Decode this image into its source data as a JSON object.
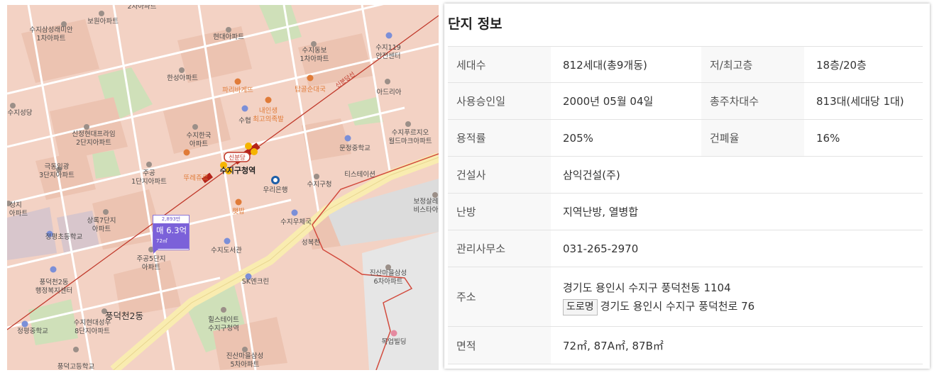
{
  "map": {
    "labels": {
      "suji_samsung_raemian": [
        "수지삼성래미안",
        "1차아파트"
      ],
      "bowon_apt": "보원아파트",
      "hyundai_apt": "현대아파트",
      "suji_dongbo": [
        "수지동보",
        "1차아파트"
      ],
      "suji_119": [
        "수지119",
        "안전센터"
      ],
      "hansung_apt": "한성아파트",
      "paris_baguette": "파리바게뜨",
      "tapgol": "탑골순대국",
      "adria": "아드리아",
      "suji_seongdang": "수지성당",
      "suhyup": "수협",
      "naeinsaeng": [
        "내인생",
        "최고의족발"
      ],
      "sinjeong_hyundai": [
        "신정현대프라임",
        "2단지아파트"
      ],
      "suji_hanguk": [
        "수지한국",
        "아파트"
      ],
      "munjeong_school": "문정중학교",
      "suji_purgio": [
        "수지푸르지오",
        "월드마크아파트"
      ],
      "geukdong": [
        "극동임광",
        "3단지아파트"
      ],
      "jugong1": [
        "주공",
        "1단지아파트"
      ],
      "tous_les_jours": "뚜레쥬르",
      "suji_gu_station": "수지구청역",
      "sinbundang": "신분당",
      "sinbundang_line": "신분당선",
      "woori_bank": "우리은행",
      "suji_gu_office": "수지구청",
      "tistation": "티스테이션",
      "bojeong": [
        "보정살레",
        "비스타아"
      ],
      "suji_left": [
        "성지",
        "아파트"
      ],
      "sangnok7": [
        "상록7단지",
        "아파트"
      ],
      "haengbap": "햇밥",
      "suji_post": "수지우체국",
      "jeongpyeong_elem": "정평초등학교",
      "jugong5": [
        "주공5단지",
        "아파트"
      ],
      "suji_library": "수지도서관",
      "seongbokcheon": "성복천",
      "pungdeokcheon2_center": [
        "풍덕천2동",
        "행정복지센터"
      ],
      "sk_enclean": "SK엔크린",
      "jinsan3": [
        "진산마을삼성",
        "6차아파트"
      ],
      "pungdeokcheon2": "풍덕천2동",
      "suji_hyundai_seongu": [
        "수지현대성우",
        "8단지아파트"
      ],
      "hillstate": [
        "힐스테이트",
        "수지구청역"
      ],
      "jeongpyeong_mid": "정평중학교",
      "mokeup": "목업빌딩",
      "jinsan5": [
        "진산마을삼성",
        "5차아파트"
      ],
      "pungdeok_high": "풍덕고등학교",
      "top_cut": "2차아파트"
    },
    "marker": {
      "count": "2,893만",
      "price": "매 6.3억",
      "area": "72㎡"
    },
    "colors": {
      "land": "#f3d2c4",
      "block": "#ecc3b1",
      "park": "#cfe0b9",
      "road": "#ffffff",
      "main_road": "#f9ecb0",
      "rail": "#c0392b",
      "marker": "#7b61d9"
    }
  },
  "panel": {
    "title": "단지 정보",
    "rows": [
      {
        "k1": "세대수",
        "v1": "812세대(총9개동)",
        "k2": "저/최고층",
        "v2": "18층/20층"
      },
      {
        "k1": "사용승인일",
        "v1": "2000년 05월 04일",
        "k2": "총주차대수",
        "v2": "813대(세대당 1대)"
      },
      {
        "k1": "용적률",
        "v1": "205%",
        "k2": "건폐율",
        "v2": "16%"
      },
      {
        "k1": "건설사",
        "v1": "삼익건설(주)"
      },
      {
        "k1": "난방",
        "v1": "지역난방, 열병합"
      },
      {
        "k1": "관리사무소",
        "v1": "031-265-2970"
      },
      {
        "k1": "주소",
        "v1": "경기도 용인시 수지구 풍덕천동 1104",
        "tag": "도로명",
        "v1b": "경기도 용인시 수지구 풍덕천로 76"
      },
      {
        "k1": "면적",
        "v1": "72㎡, 87A㎡, 87B㎡"
      }
    ]
  }
}
